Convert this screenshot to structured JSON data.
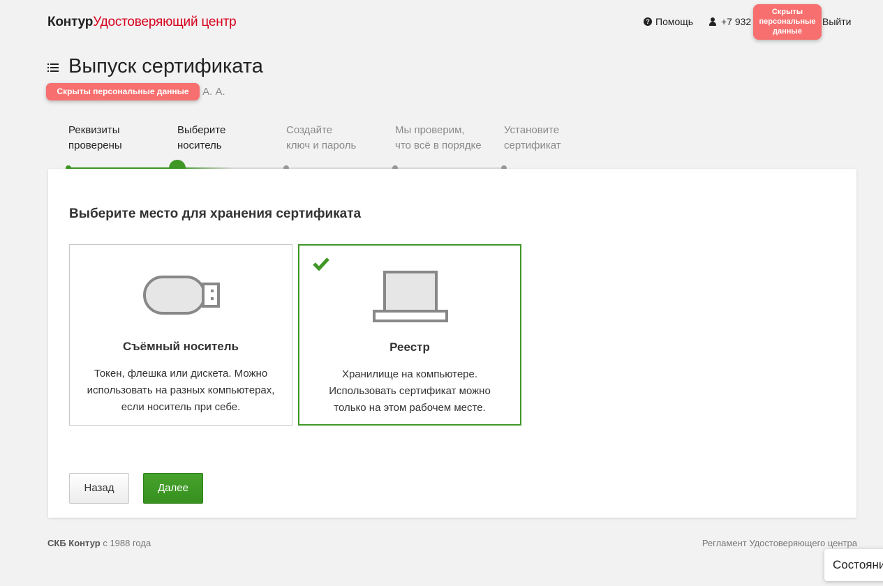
{
  "header": {
    "brand": "Контур",
    "product": "Удостоверяющий центр",
    "help_label": "Помощь",
    "phone_prefix": "+7 932",
    "redacted_label": "Скрыты персональные данные",
    "logout_label": "Выйти"
  },
  "page": {
    "title": "Выпуск сертификата",
    "subtitle_redacted": "Скрыты персональные данные",
    "subtitle_visible": "в А. А."
  },
  "steps": [
    {
      "line1": "Реквизиты",
      "line2": "проверены",
      "state": "done"
    },
    {
      "line1": "Выберите",
      "line2": "носитель",
      "state": "current"
    },
    {
      "line1": "Создайте",
      "line2": "ключ и пароль",
      "state": "future"
    },
    {
      "line1": "Мы проверим,",
      "line2": "что всё в порядке",
      "state": "future"
    },
    {
      "line1": "Установите",
      "line2": "сертификат",
      "state": "future"
    }
  ],
  "card": {
    "heading": "Выберите место для хранения сертификата",
    "options": [
      {
        "icon": "usb-drive-icon",
        "title": "Съёмный носитель",
        "desc1": "Токен, флешка или дискета. Можно",
        "desc2": "использовать на разных компьютерах,",
        "desc3": "если носитель при себе.",
        "selected": false
      },
      {
        "icon": "laptop-icon",
        "title": "Реестр",
        "desc1": "Хранилище на компьютере.",
        "desc2": "Использовать сертификат можно",
        "desc3": "только на этом рабочем месте.",
        "selected": true
      }
    ],
    "back_label": "Назад",
    "next_label": "Далее"
  },
  "footer": {
    "company": "СКБ Контур",
    "since": "с 1988 года",
    "regulation_link": "Регламент Удостоверяющего центра",
    "status_widget": "Состояние"
  },
  "colors": {
    "accent_green": "#3f9726",
    "brand_red": "#d6001c",
    "redaction": "#f7706f"
  }
}
